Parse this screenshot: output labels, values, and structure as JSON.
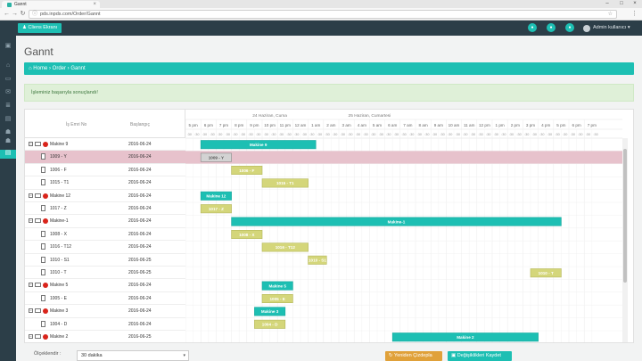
{
  "browser": {
    "tab_title": "Gannt",
    "url": "pds.inpds.com/Order/Gannt"
  },
  "topbar": {
    "client_button": "Cliens Ekranı",
    "user_name": "Admin kullanıcı"
  },
  "page": {
    "title": "Gannt",
    "breadcrumb": [
      "Home",
      "Order",
      "Gannt"
    ],
    "alert": "İşleminiz başarıyla sonuçlandı!"
  },
  "grid": {
    "col_name": "İş Emri No",
    "col_start": "Başlangıç",
    "rows": [
      {
        "name": "Makine 9",
        "date": "2016-06-24",
        "type": "parent"
      },
      {
        "name": "1009 - Y",
        "date": "2016-06-24",
        "type": "child",
        "selected": true
      },
      {
        "name": "1006 - F",
        "date": "2016-06-24",
        "type": "child"
      },
      {
        "name": "1015 - T1",
        "date": "2016-06-24",
        "type": "child"
      },
      {
        "name": "Makine 12",
        "date": "2016-06-24",
        "type": "parent"
      },
      {
        "name": "1017 - Z",
        "date": "2016-06-24",
        "type": "child"
      },
      {
        "name": "Makine-1",
        "date": "2016-06-24",
        "type": "parent"
      },
      {
        "name": "1008 - X",
        "date": "2016-06-24",
        "type": "child"
      },
      {
        "name": "1016 - T12",
        "date": "2016-06-24",
        "type": "child"
      },
      {
        "name": "1010 - S1",
        "date": "2016-06-25",
        "type": "child"
      },
      {
        "name": "1010 - T",
        "date": "2016-06-25",
        "type": "child"
      },
      {
        "name": "Makine 5",
        "date": "2016-06-24",
        "type": "parent"
      },
      {
        "name": "1005 - E",
        "date": "2016-06-24",
        "type": "child"
      },
      {
        "name": "Makine 3",
        "date": "2016-06-24",
        "type": "parent"
      },
      {
        "name": "1004 - D",
        "date": "2016-06-24",
        "type": "child"
      },
      {
        "name": "Makine 2",
        "date": "2016-06-25",
        "type": "parent"
      }
    ]
  },
  "timeline": {
    "day_labels": [
      "24 Haziran, Cuma",
      "25 Haziran, Cumartesi"
    ],
    "hour_labels": [
      "5 pm",
      "6 pm",
      "7 pm",
      "8 pm",
      "9 pm",
      "10 pm",
      "11 pm",
      "12 am",
      "1 am",
      "2 am",
      "3 am",
      "4 am",
      "5 am",
      "6 am",
      "7 am",
      "8 am",
      "9 am",
      "10 am",
      "11 am",
      "12 pm",
      "1 pm",
      "2 pm",
      "3 pm",
      "4 pm",
      "5 pm",
      "6 pm",
      "7 pm"
    ],
    "minute_label": ":30",
    "bars": [
      {
        "row": 0,
        "label": "Makine 9",
        "start": 1.0,
        "end": 8.5,
        "kind": "parent"
      },
      {
        "row": 1,
        "label": "1009 - Y",
        "start": 1.0,
        "end": 3.0,
        "kind": "selected"
      },
      {
        "row": 2,
        "label": "1006 - F",
        "start": 3.0,
        "end": 5.0,
        "kind": "task"
      },
      {
        "row": 3,
        "label": "1015 - T1",
        "start": 5.0,
        "end": 8.0,
        "kind": "task"
      },
      {
        "row": 4,
        "label": "Makine 12",
        "start": 1.0,
        "end": 3.0,
        "kind": "parent"
      },
      {
        "row": 5,
        "label": "1017 - Z",
        "start": 1.0,
        "end": 3.0,
        "kind": "task"
      },
      {
        "row": 6,
        "label": "Makine-1",
        "start": 3.0,
        "end": 24.5,
        "kind": "parent"
      },
      {
        "row": 7,
        "label": "1008 - X",
        "start": 3.0,
        "end": 5.0,
        "kind": "task"
      },
      {
        "row": 8,
        "label": "1016 - T12",
        "start": 5.0,
        "end": 8.0,
        "kind": "task"
      },
      {
        "row": 9,
        "label": "1010 - S1",
        "start": 8.0,
        "end": 9.2,
        "kind": "task"
      },
      {
        "row": 10,
        "label": "1010 - T",
        "start": 22.5,
        "end": 24.5,
        "kind": "task"
      },
      {
        "row": 11,
        "label": "Makine 5",
        "start": 5.0,
        "end": 7.0,
        "kind": "parent"
      },
      {
        "row": 12,
        "label": "1005 - E",
        "start": 5.0,
        "end": 7.0,
        "kind": "task"
      },
      {
        "row": 13,
        "label": "Makine 3",
        "start": 4.5,
        "end": 6.5,
        "kind": "parent"
      },
      {
        "row": 14,
        "label": "1004 - D",
        "start": 4.5,
        "end": 6.5,
        "kind": "task"
      },
      {
        "row": 15,
        "label": "Makine 2",
        "start": 13.5,
        "end": 23.0,
        "kind": "parent"
      }
    ]
  },
  "footer": {
    "scale_label": "Ölçeklendir :",
    "scale_value": "30 dakika",
    "refresh_button": "Yeniden Çizdepla",
    "save_button": "Değişiklikleri Kaydet"
  },
  "colors": {
    "accent": "#1dbfb3",
    "task": "#d4d67a",
    "selected_row": "#e7c2cc",
    "dark": "#2c3e48"
  }
}
